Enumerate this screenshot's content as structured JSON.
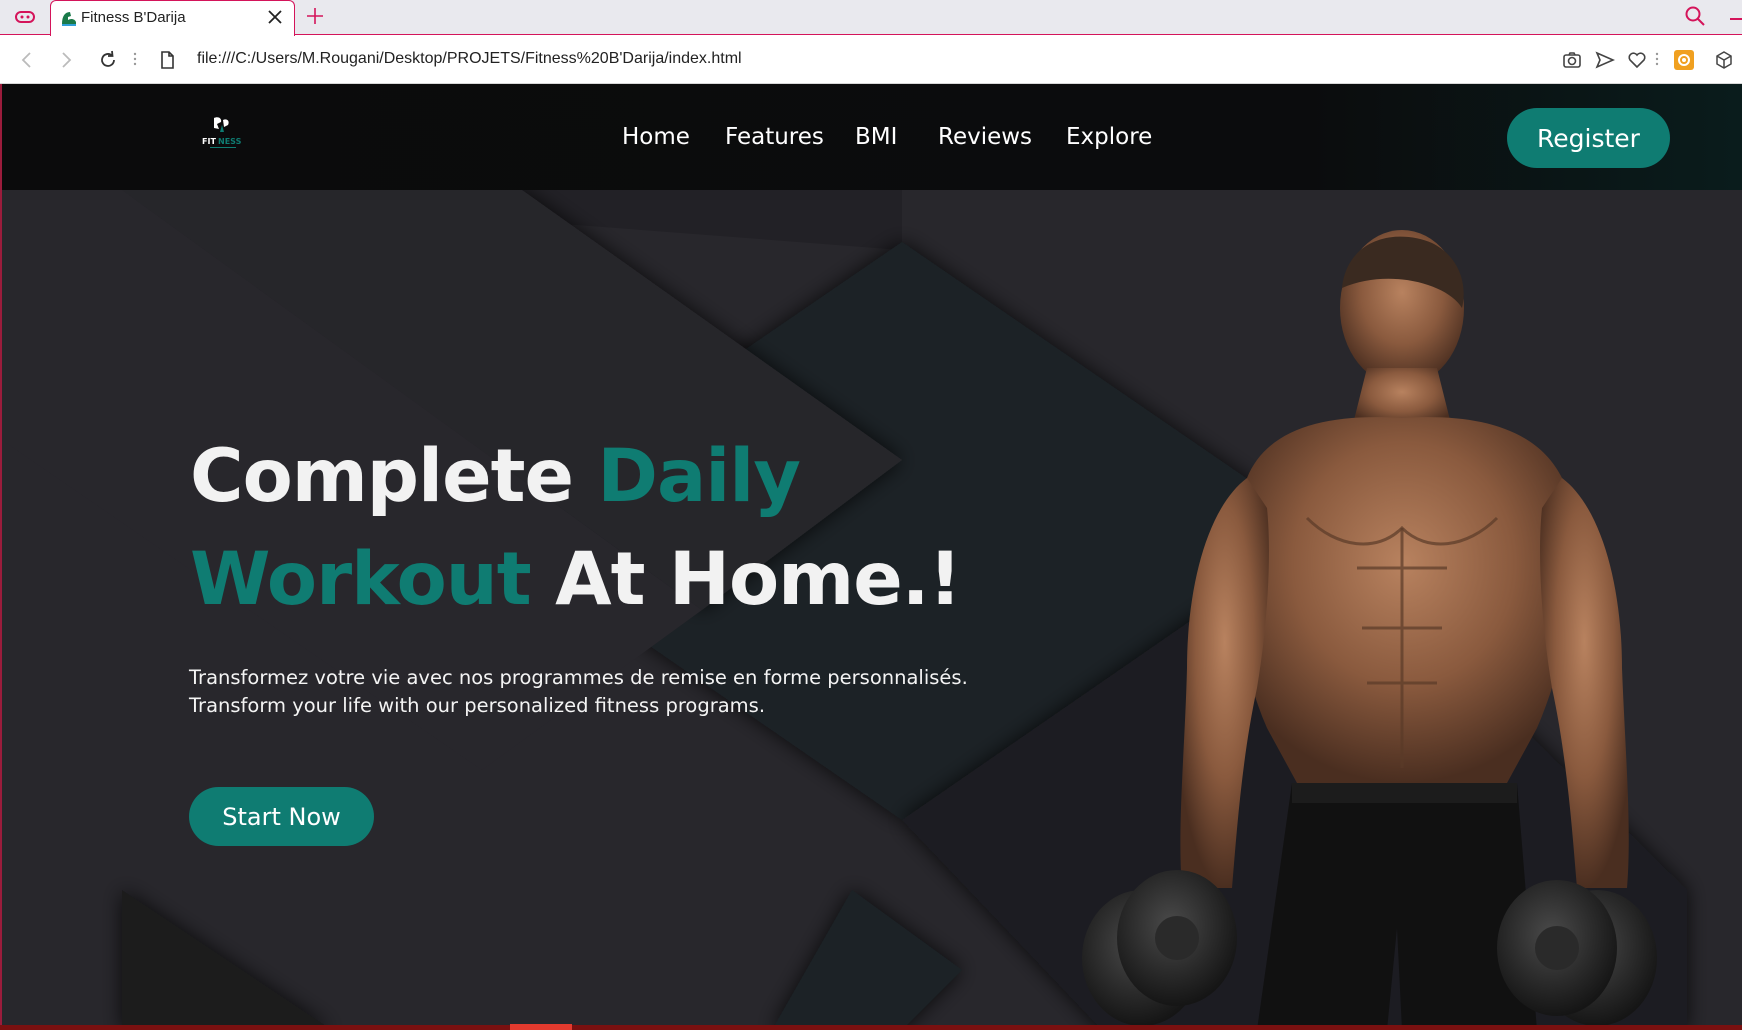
{
  "browser": {
    "tab": {
      "title": "Fitness B'Darija"
    },
    "address_bar": {
      "url": "file:///C:/Users/M.Rougani/Desktop/PROJETS/Fitness%20B'Darija/index.html"
    },
    "icons": [
      "gamepad-icon",
      "close-icon",
      "plus-icon",
      "search-icon",
      "back-icon",
      "forward-icon",
      "reload-icon",
      "file-icon",
      "camera-icon",
      "send-icon",
      "heart-icon",
      "extension-icon",
      "cube-icon"
    ],
    "accent_color": "#d4145a"
  },
  "site": {
    "logo_text": "FITNESS",
    "nav": [
      {
        "label": "Home"
      },
      {
        "label": "Features"
      },
      {
        "label": "BMI"
      },
      {
        "label": "Reviews"
      },
      {
        "label": "Explore"
      }
    ],
    "register_label": "Register",
    "brand_color": "#0f7c72"
  },
  "hero": {
    "headline": {
      "line1_a": "Complete",
      "line1_b": "Daily",
      "line2_a": "Workout",
      "line2_b": "At Home.!"
    },
    "text_fr": "Transformez votre vie avec nos programmes de remise en forme personnalisés.",
    "text_en": "Transform your life with our personalized fitness programs.",
    "cta_label": "Start Now"
  }
}
